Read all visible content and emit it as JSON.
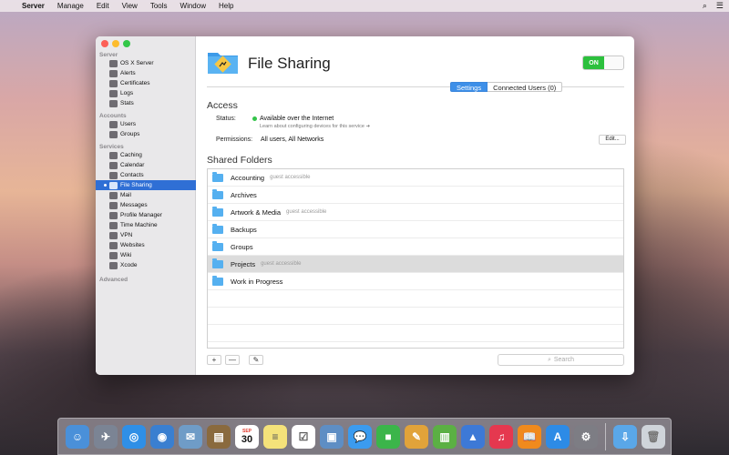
{
  "menubar": {
    "app": "Server",
    "items": [
      "Manage",
      "Edit",
      "View",
      "Tools",
      "Window",
      "Help"
    ]
  },
  "sidebar": {
    "sections": {
      "server": "Server",
      "accounts": "Accounts",
      "services": "Services",
      "advanced": "Advanced"
    },
    "server_items": [
      "OS X Server",
      "Alerts",
      "Certificates",
      "Logs",
      "Stats"
    ],
    "account_items": [
      "Users",
      "Groups"
    ],
    "service_items": [
      "Caching",
      "Calendar",
      "Contacts",
      "File Sharing",
      "Mail",
      "Messages",
      "Profile Manager",
      "Time Machine",
      "VPN",
      "Websites",
      "Wiki",
      "Xcode"
    ],
    "selected": "File Sharing"
  },
  "header": {
    "title": "File Sharing",
    "toggle": "ON"
  },
  "tabs": [
    "Settings",
    "Connected Users (0)"
  ],
  "access": {
    "heading": "Access",
    "status_label": "Status:",
    "status_value": "Available over the Internet",
    "status_link": "Learn about configuring devices for this service",
    "permissions_label": "Permissions:",
    "permissions_value": "All users, All Networks",
    "edit_button": "Edit..."
  },
  "shared": {
    "heading": "Shared Folders",
    "folders": [
      {
        "name": "Accounting",
        "note": "guest accessible"
      },
      {
        "name": "Archives",
        "note": ""
      },
      {
        "name": "Artwork & Media",
        "note": "guest accessible"
      },
      {
        "name": "Backups",
        "note": ""
      },
      {
        "name": "Groups",
        "note": ""
      },
      {
        "name": "Projects",
        "note": "guest accessible"
      },
      {
        "name": "Work in Progress",
        "note": ""
      }
    ],
    "selected": "Projects"
  },
  "bottom": {
    "add": "+",
    "remove": "—",
    "edit": "✎",
    "search_placeholder": "Search"
  },
  "dock": {
    "calendar_month": "SEP",
    "calendar_day": "30"
  },
  "colors": {
    "accent": "#2f6fd5",
    "toggle_on": "#2cc03d",
    "status_green": "#34c44a",
    "folder_blue": "#55b0f0"
  }
}
